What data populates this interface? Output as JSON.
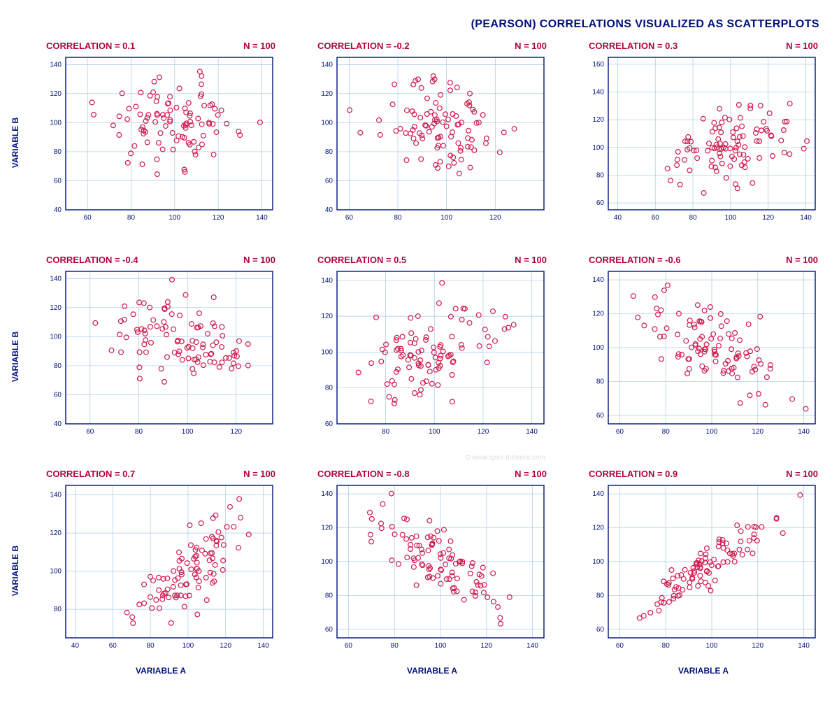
{
  "title": "(PEARSON) CORRELATIONS VISUALIZED AS SCATTERPLOTS",
  "watermark": "© www.spss-tutorials.com",
  "axis_labels": {
    "x": "VARIABLE A",
    "y": "VARIABLE B"
  },
  "colors": {
    "text": "#00127a",
    "accent": "#b1043c",
    "point": "#cf1b4e",
    "grid": "#a9c9e6"
  },
  "panel_defaults": {
    "n_label_prefix": "N = ",
    "corr_label_prefix": "CORRELATION = "
  },
  "chart_data": [
    {
      "type": "scatter",
      "title_left": "CORRELATION = 0.1",
      "title_right": "N = 100",
      "correlation": 0.1,
      "n": 100,
      "xlabel": "VARIABLE A",
      "ylabel": "VARIABLE B",
      "xlim": [
        50,
        145
      ],
      "ylim": [
        40,
        145
      ],
      "xticks": [
        60,
        80,
        100,
        120,
        140
      ],
      "yticks": [
        40,
        60,
        80,
        100,
        120,
        140
      ],
      "show_ylabel": true,
      "show_xlabel": false
    },
    {
      "type": "scatter",
      "title_left": "CORRELATION = -0.2",
      "title_right": "N = 100",
      "correlation": -0.2,
      "n": 100,
      "xlabel": "VARIABLE A",
      "ylabel": "VARIABLE B",
      "xlim": [
        55,
        140
      ],
      "ylim": [
        40,
        145
      ],
      "xticks": [
        60,
        80,
        100,
        120
      ],
      "yticks": [
        40,
        60,
        80,
        100,
        120,
        140
      ],
      "show_ylabel": false,
      "show_xlabel": false
    },
    {
      "type": "scatter",
      "title_left": "CORRELATION = 0.3",
      "title_right": "N = 100",
      "correlation": 0.3,
      "n": 100,
      "xlabel": "VARIABLE A",
      "ylabel": "VARIABLE B",
      "xlim": [
        35,
        145
      ],
      "ylim": [
        55,
        165
      ],
      "xticks": [
        40,
        60,
        80,
        100,
        120,
        140
      ],
      "yticks": [
        60,
        80,
        100,
        120,
        140,
        160
      ],
      "show_ylabel": false,
      "show_xlabel": false
    },
    {
      "type": "scatter",
      "title_left": "CORRELATION = -0.4",
      "title_right": "N = 100",
      "correlation": -0.4,
      "n": 100,
      "xlabel": "VARIABLE A",
      "ylabel": "VARIABLE B",
      "xlim": [
        50,
        135
      ],
      "ylim": [
        40,
        145
      ],
      "xticks": [
        60,
        80,
        100,
        120
      ],
      "yticks": [
        40,
        60,
        80,
        100,
        120,
        140
      ],
      "show_ylabel": true,
      "show_xlabel": false
    },
    {
      "type": "scatter",
      "title_left": "CORRELATION = 0.5",
      "title_right": "N = 100",
      "correlation": 0.5,
      "n": 100,
      "xlabel": "VARIABLE A",
      "ylabel": "VARIABLE B",
      "xlim": [
        60,
        145
      ],
      "ylim": [
        60,
        145
      ],
      "xticks": [
        80,
        100,
        120,
        140
      ],
      "yticks": [
        60,
        80,
        100,
        120,
        140
      ],
      "show_ylabel": false,
      "show_xlabel": false,
      "watermark": true
    },
    {
      "type": "scatter",
      "title_left": "CORRELATION = -0.6",
      "title_right": "N = 100",
      "correlation": -0.6,
      "n": 100,
      "xlabel": "VARIABLE A",
      "ylabel": "VARIABLE B",
      "xlim": [
        55,
        145
      ],
      "ylim": [
        55,
        145
      ],
      "xticks": [
        60,
        80,
        100,
        120,
        140
      ],
      "yticks": [
        60,
        80,
        100,
        120,
        140
      ],
      "show_ylabel": false,
      "show_xlabel": false
    },
    {
      "type": "scatter",
      "title_left": "CORRELATION = 0.7",
      "title_right": "N = 100",
      "correlation": 0.7,
      "n": 100,
      "xlabel": "VARIABLE A",
      "ylabel": "VARIABLE B",
      "xlim": [
        35,
        145
      ],
      "ylim": [
        65,
        145
      ],
      "xticks": [
        40,
        60,
        80,
        100,
        120,
        140
      ],
      "yticks": [
        80,
        100,
        120,
        140
      ],
      "show_ylabel": true,
      "show_xlabel": true
    },
    {
      "type": "scatter",
      "title_left": "CORRELATION = -0.8",
      "title_right": "N = 100",
      "correlation": -0.8,
      "n": 100,
      "xlabel": "VARIABLE A",
      "ylabel": "VARIABLE B",
      "xlim": [
        55,
        145
      ],
      "ylim": [
        55,
        145
      ],
      "xticks": [
        60,
        80,
        100,
        120,
        140
      ],
      "yticks": [
        60,
        80,
        100,
        120,
        140
      ],
      "show_ylabel": false,
      "show_xlabel": true
    },
    {
      "type": "scatter",
      "title_left": "CORRELATION = 0.9",
      "title_right": "N = 100",
      "correlation": 0.9,
      "n": 100,
      "xlabel": "VARIABLE A",
      "ylabel": "VARIABLE B",
      "xlim": [
        55,
        145
      ],
      "ylim": [
        55,
        145
      ],
      "xticks": [
        60,
        80,
        100,
        120,
        140
      ],
      "yticks": [
        60,
        80,
        100,
        120,
        140
      ],
      "show_ylabel": false,
      "show_xlabel": true
    }
  ]
}
